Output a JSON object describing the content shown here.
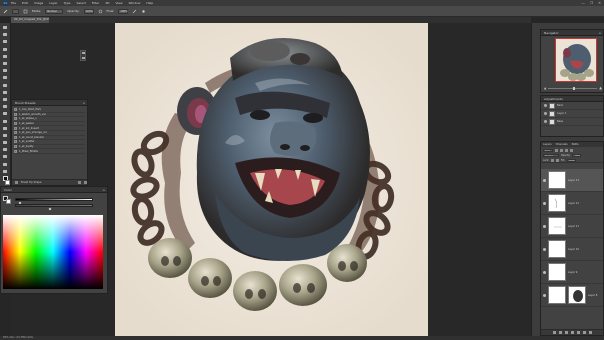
{
  "menubar": {
    "logo": "Ps",
    "items": [
      "File",
      "Edit",
      "Image",
      "Layer",
      "Type",
      "Select",
      "Filter",
      "3D",
      "View",
      "Window",
      "Help"
    ],
    "controls": [
      "—",
      "❐",
      "✕"
    ]
  },
  "optionsbar": {
    "mode_value": "Normal",
    "opacity_value": "100%",
    "flow_value": "100%"
  },
  "document": {
    "tab_title": "OK_DU_Cropped_15k_@50% (RGB/8*) ×"
  },
  "actions_panel": {
    "title": "Brush Presets",
    "items": [
      "1_Cop_Paint_H&S",
      "1_sketch_smooth_var",
      "1_sk_ellipse_v",
      "1_sk_pastel",
      "1_sk_ink_lineart",
      "1_sk_pen_smudge_cur",
      "1_sk_round_blender",
      "1_sk_scatter",
      "1_sk_liquify",
      "1_Mixer_Bristle"
    ],
    "footer_label": "Brush Tip Shape"
  },
  "color_panel": {
    "title": "Color",
    "fg_color": "#161616",
    "bg_color": "#ffffff"
  },
  "navigator": {
    "title": "Navigator",
    "zoom_value": 0.5
  },
  "adjust_panel": {
    "title": "Adjustments",
    "rows": [
      {
        "label": "Back"
      },
      {
        "label": "Layer 1"
      },
      {
        "label": "Base"
      }
    ]
  },
  "layers_panel": {
    "tabs": [
      "Layers",
      "Channels",
      "Paths"
    ],
    "kind_label": "Kind",
    "blend_mode": "Normal",
    "opacity_label": "Opacity:",
    "opacity_value": "100%",
    "fill_label": "Fill:",
    "fill_value": "100%",
    "layers": [
      {
        "name": "Layer 13",
        "selected": true
      },
      {
        "name": "Layer 12",
        "selected": false
      },
      {
        "name": "Layer 11",
        "selected": false
      },
      {
        "name": "Layer 10",
        "selected": false
      },
      {
        "name": "Layer 9",
        "selected": false
      },
      {
        "name": "Layer 8",
        "selected": false
      }
    ]
  },
  "statusbar": {
    "text": "50%    Doc: 24.7M/1.02G"
  }
}
